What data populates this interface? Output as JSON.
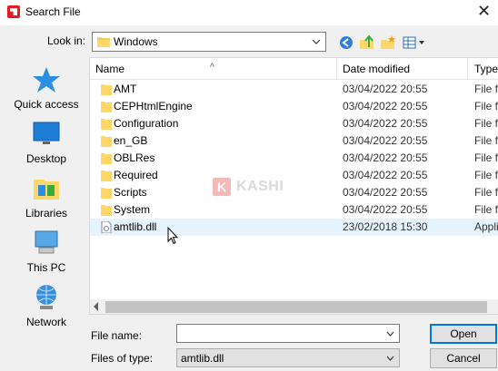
{
  "window": {
    "title": "Search File"
  },
  "look_in": {
    "label": "Look in:",
    "value": "Windows"
  },
  "toolbar": {
    "icons": [
      "back-icon",
      "up-folder-icon",
      "new-folder-icon",
      "view-menu-icon"
    ]
  },
  "places": [
    {
      "label": "Quick access",
      "icon": "star-icon"
    },
    {
      "label": "Desktop",
      "icon": "desktop-icon"
    },
    {
      "label": "Libraries",
      "icon": "libraries-icon"
    },
    {
      "label": "This PC",
      "icon": "computer-icon"
    },
    {
      "label": "Network",
      "icon": "network-icon"
    }
  ],
  "columns": {
    "name": "Name",
    "date": "Date modified",
    "type": "Type"
  },
  "files": [
    {
      "name": "AMT",
      "date": "03/04/2022 20:55",
      "type": "File fo",
      "kind": "folder"
    },
    {
      "name": "CEPHtmlEngine",
      "date": "03/04/2022 20:55",
      "type": "File fo",
      "kind": "folder"
    },
    {
      "name": "Configuration",
      "date": "03/04/2022 20:55",
      "type": "File fo",
      "kind": "folder"
    },
    {
      "name": "en_GB",
      "date": "03/04/2022 20:55",
      "type": "File fo",
      "kind": "folder"
    },
    {
      "name": "OBLRes",
      "date": "03/04/2022 20:55",
      "type": "File fo",
      "kind": "folder"
    },
    {
      "name": "Required",
      "date": "03/04/2022 20:55",
      "type": "File fo",
      "kind": "folder"
    },
    {
      "name": "Scripts",
      "date": "03/04/2022 20:55",
      "type": "File fo",
      "kind": "folder"
    },
    {
      "name": "System",
      "date": "03/04/2022 20:55",
      "type": "File fo",
      "kind": "folder"
    },
    {
      "name": "amtlib.dll",
      "date": "23/02/2018 15:30",
      "type": "Appli",
      "kind": "dll",
      "hovered": true
    }
  ],
  "watermark": {
    "badge": "K",
    "text": "KASHI"
  },
  "form": {
    "file_name_label": "File name:",
    "file_name_value": "",
    "file_type_label": "Files of type:",
    "file_type_value": "amtlib.dll"
  },
  "buttons": {
    "open": "Open",
    "cancel": "Cancel"
  },
  "colors": {
    "selection": "#e5f3ff",
    "folder": "#ffd768",
    "accent": "#0078d7"
  }
}
